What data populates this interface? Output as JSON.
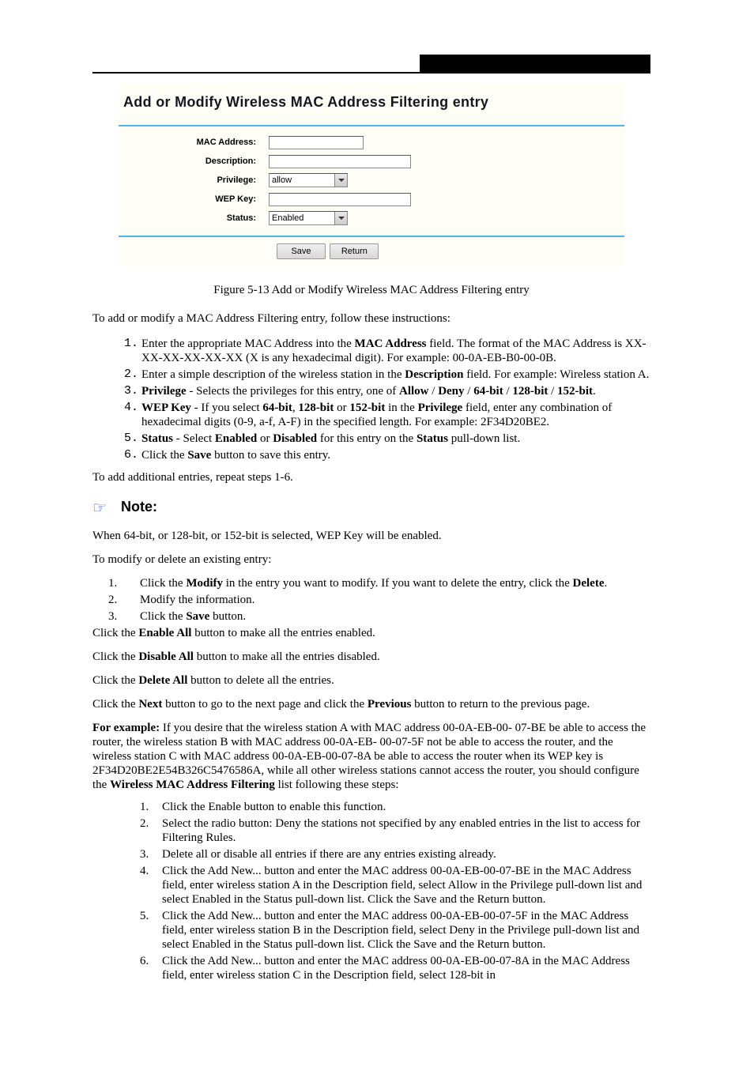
{
  "form": {
    "title": "Add or Modify Wireless MAC Address Filtering entry",
    "labels": {
      "mac": "MAC Address:",
      "desc": "Description:",
      "priv": "Privilege:",
      "wep": "WEP Key:",
      "status": "Status:"
    },
    "values": {
      "priv": "allow",
      "status": "Enabled"
    },
    "buttons": {
      "save": "Save",
      "return": "Return"
    }
  },
  "caption": "Figure 5-13 Add or Modify Wireless MAC Address Filtering entry",
  "intro": "To add or modify a MAC Address Filtering entry, follow these instructions:",
  "bullets": [
    {
      "num": "1.",
      "html": "Enter the appropriate MAC Address into the <b>MAC Address</b> field. The format of the MAC Address is XX-XX-XX-XX-XX-XX (X is any hexadecimal digit). For example: 00-0A-EB-B0-00-0B."
    },
    {
      "num": "2.",
      "html": "Enter a simple description of the wireless station in the <b>Description</b> field. For example: Wireless station A."
    },
    {
      "num": "3.",
      "html": "<b>Privilege</b> - Selects the privileges for this entry, one of <b>Allow</b> / <b>Deny</b> / <b>64-bit</b> / <b>128-bit</b> / <b>152-bit</b>."
    },
    {
      "num": "4.",
      "html": "<b>WEP Key</b> - If you select <b>64-bit</b>, <b>128-bit</b> or <b>152-bit</b> in the <b>Privilege</b> field, enter any combination of hexadecimal digits (0-9, a-f, A-F) in the specified length. For example: 2F34D20BE2."
    },
    {
      "num": "5.",
      "html": "<b>Status</b> - Select <b>Enabled</b> or <b>Disabled</b> for this entry on the <b>Status</b> pull-down list."
    },
    {
      "num": "6.",
      "html": "Click the <b>Save</b> button to save this entry."
    }
  ],
  "modifyPara": "To add additional entries, repeat steps 1-6.",
  "noteLabel": "Note:",
  "noteText": "When 64-bit, or 128-bit, or 152-bit is selected, WEP Key will be enabled.",
  "modifyIntro": "To modify or delete an existing entry:",
  "modifySteps": [
    {
      "num": "1.",
      "html": "Click the <b>Modify</b> in the entry you want to modify. If you want to delete the entry, click the <b>Delete</b>."
    },
    {
      "num": "2.",
      "html": "Modify the information."
    },
    {
      "num": "3.",
      "html": "Click the <b>Save</b> button."
    }
  ],
  "enableAll": "Click the <b>Enable All</b> button to make all the entries enabled.",
  "disableAll": "Click the <b>Disable All</b> button to make all the entries disabled.",
  "deleteAll": "Click the <b>Delete All</b> button to delete all the entries.",
  "navPara": "Click the <b>Next</b> button to go to the next page and click the <b>Previous</b> button to return to the previous page.",
  "exampleIntro": "<b>For example:</b> If you desire that the wireless station A with MAC address 00-0A-EB-00- 07-BE be able to access the router, the wireless station B with MAC address 00-0A-EB- 00-07-5F not be able to access the router, and the wireless station C with MAC address 00-0A-EB-00-07-8A be able to access the router when its WEP key is 2F34D20BE2E54B326C5476586A, while all other wireless stations cannot access the router, you should configure the <b>Wireless MAC Address Filtering</b> list following these steps:",
  "exampleSteps": [
    {
      "num": "1.",
      "txt": "Click the Enable button to enable this function."
    },
    {
      "num": "2.",
      "txt": "Select the radio button: Deny the stations not specified by any enabled entries in the list to access for Filtering Rules."
    },
    {
      "num": "3.",
      "txt": "Delete all or disable all entries if there are any entries existing already."
    },
    {
      "num": "4.",
      "txt": "Click the Add New... button and enter the MAC address 00-0A-EB-00-07-BE in the MAC Address field, enter wireless station A in the Description field, select Allow in the Privilege pull-down list and select Enabled in the Status pull-down list. Click the Save and the Return button."
    },
    {
      "num": "5.",
      "txt": "Click the Add New... button and enter the MAC address 00-0A-EB-00-07-5F in the MAC Address field, enter wireless station B in the Description field, select Deny in the Privilege pull-down list and select Enabled in the Status pull-down list. Click the Save and the Return button."
    },
    {
      "num": "6.",
      "txt": "Click the Add New... button and enter the MAC address 00-0A-EB-00-07-8A in the MAC Address field, enter wireless station C in the Description field, select 128-bit in"
    }
  ]
}
